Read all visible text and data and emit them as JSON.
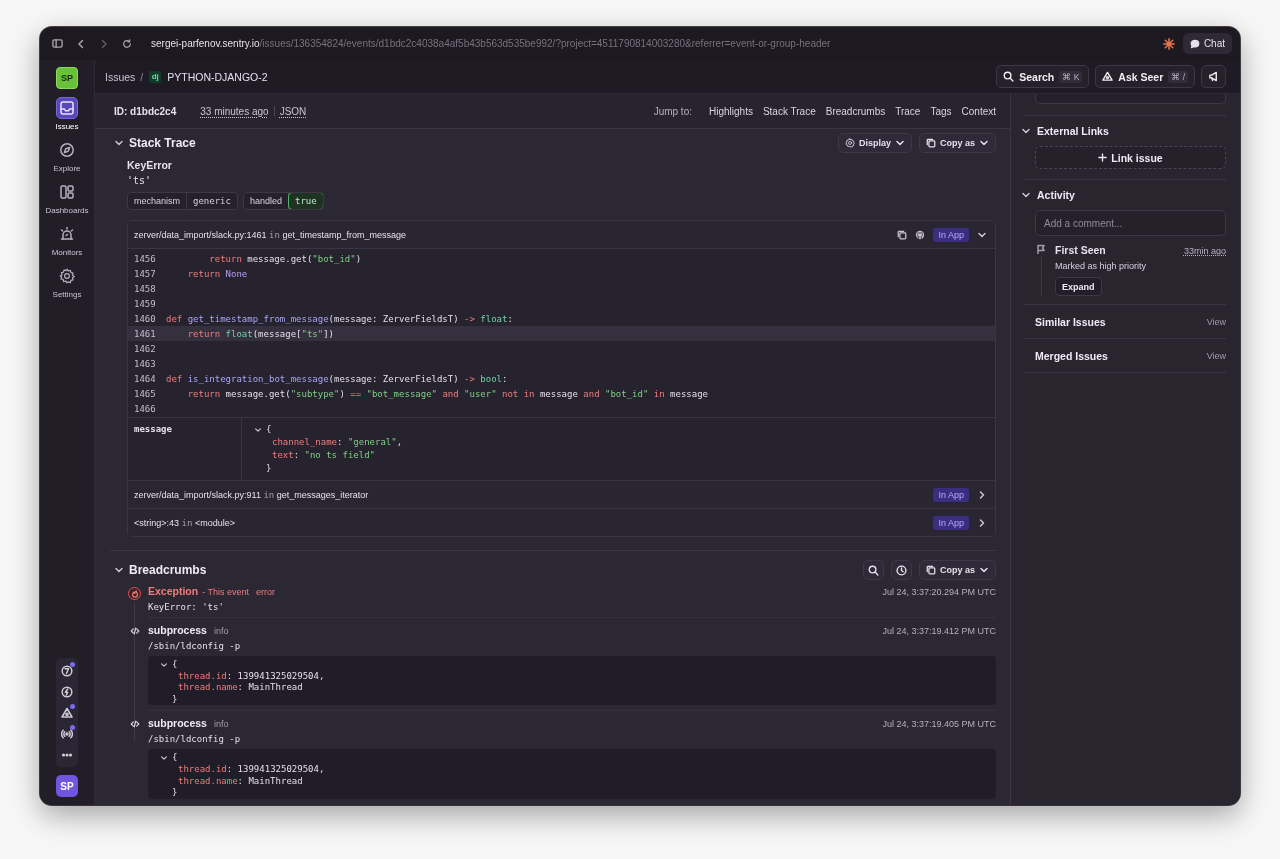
{
  "browser": {
    "url_host": "sergei-parfenov.sentry.io",
    "url_path": "/issues/136354824/events/d1bdc2c4038a4af5b43b563d535be992/?project=4511790814003280&referrer=event-or-group-header",
    "chat": "Chat"
  },
  "org_badge": "SP",
  "nav": [
    {
      "label": "Issues",
      "selected": true
    },
    {
      "label": "Explore",
      "selected": false
    },
    {
      "label": "Dashboards",
      "selected": false
    },
    {
      "label": "Monitors",
      "selected": false
    },
    {
      "label": "Settings",
      "selected": false
    }
  ],
  "nav_tools": [
    {
      "notified": true
    },
    {
      "notified": false
    },
    {
      "notified": true
    },
    {
      "notified": true
    },
    {
      "notified": false
    }
  ],
  "user_avatar": "SP",
  "header": {
    "breadcrumb": "Issues",
    "separator": "/",
    "project_icon": "dj",
    "project": "PYTHON-DJANGO-2",
    "search": "Search",
    "search_key": "⌘ K",
    "seer": "Ask Seer",
    "seer_key": "⌘ /"
  },
  "event": {
    "id": "ID: d1bdc2c4",
    "time": "33 minutes ago",
    "json": "JSON",
    "jump_label": "Jump to:",
    "jump_links": [
      "Highlights",
      "Stack Trace",
      "Breadcrumbs",
      "Trace",
      "Tags",
      "Context"
    ]
  },
  "stack_trace": {
    "title": "Stack Trace",
    "display": "Display",
    "copy": "Copy as",
    "exception_type": "KeyError",
    "exception_value": "'ts'",
    "tags": [
      {
        "key": "mechanism",
        "value": "generic",
        "highlighted": false
      },
      {
        "key": "handled",
        "value": "true",
        "highlighted": true
      }
    ],
    "frames": [
      {
        "file": "zerver/data_import/slack.py:1461",
        "in": "in",
        "function": "get_timestamp_from_message",
        "badge": "In App",
        "expanded": true,
        "lines": [
          {
            "number": "1456",
            "active": false,
            "tokens": [
              {
                "text": "        return",
                "kind": "kw"
              },
              {
                "text": " message.get(",
                "kind": "p"
              },
              {
                "text": "\"bot_id\"",
                "kind": "str"
              },
              {
                "text": ")",
                "kind": "p"
              }
            ]
          },
          {
            "number": "1457",
            "active": false,
            "tokens": [
              {
                "text": "    return",
                "kind": "kw"
              },
              {
                "text": " None",
                "kind": "const"
              }
            ]
          },
          {
            "number": "1458",
            "active": false
          },
          {
            "number": "1459",
            "active": false
          },
          {
            "number": "1460",
            "active": false,
            "tokens": [
              {
                "text": "def",
                "kind": "kw"
              },
              {
                "text": " get_timestamp_from_message",
                "kind": "fn"
              },
              {
                "text": "(message: ZerverFieldsT) ",
                "kind": "p"
              },
              {
                "text": "->",
                "kind": "kw"
              },
              {
                "text": " float",
                "kind": "builtin"
              },
              {
                "text": ":",
                "kind": "p"
              }
            ]
          },
          {
            "number": "1461",
            "active": true,
            "tokens": [
              {
                "text": "    return",
                "kind": "kw"
              },
              {
                "text": " float",
                "kind": "builtin"
              },
              {
                "text": "(message[",
                "kind": "p"
              },
              {
                "text": "\"ts\"",
                "kind": "str"
              },
              {
                "text": "])",
                "kind": "p"
              }
            ]
          },
          {
            "number": "1462",
            "active": false
          },
          {
            "number": "1463",
            "active": false
          },
          {
            "number": "1464",
            "active": false,
            "tokens": [
              {
                "text": "def",
                "kind": "kw"
              },
              {
                "text": " is_integration_bot_message",
                "kind": "fn"
              },
              {
                "text": "(message: ZerverFieldsT) ",
                "kind": "p"
              },
              {
                "text": "->",
                "kind": "kw"
              },
              {
                "text": " bool",
                "kind": "builtin"
              },
              {
                "text": ":",
                "kind": "p"
              }
            ]
          },
          {
            "number": "1465",
            "active": false,
            "tokens": [
              {
                "text": "    return",
                "kind": "kw"
              },
              {
                "text": " message.get(",
                "kind": "p"
              },
              {
                "text": "\"subtype\"",
                "kind": "str"
              },
              {
                "text": ") ",
                "kind": "p"
              },
              {
                "text": "==",
                "kind": "kw"
              },
              {
                "text": " \"bot_message\"",
                "kind": "str"
              },
              {
                "text": " and",
                "kind": "kw"
              },
              {
                "text": " \"user\"",
                "kind": "str"
              },
              {
                "text": " not in",
                "kind": "kw"
              },
              {
                "text": " message ",
                "kind": "p"
              },
              {
                "text": "and",
                "kind": "kw"
              },
              {
                "text": " \"bot_id\"",
                "kind": "str"
              },
              {
                "text": " in",
                "kind": "kw"
              },
              {
                "text": " message",
                "kind": "p"
              }
            ]
          },
          {
            "number": "1466",
            "active": false
          }
        ],
        "variables": [
          {
            "name": "message",
            "lines": [
              [
                {
                  "text": "{",
                  "kind": "p"
                }
              ],
              [
                {
                  "text": "channel_name",
                  "kind": "key"
                },
                {
                  "text": ": ",
                  "kind": "p"
                },
                {
                  "text": "\"general\"",
                  "kind": "str"
                },
                {
                  "text": ",",
                  "kind": "p"
                }
              ],
              [
                {
                  "text": "text",
                  "kind": "key"
                },
                {
                  "text": ": ",
                  "kind": "p"
                },
                {
                  "text": "\"no ts field\"",
                  "kind": "str"
                }
              ],
              [
                {
                  "text": "}",
                  "kind": "p"
                }
              ]
            ]
          }
        ]
      },
      {
        "file": "zerver/data_import/slack.py:911",
        "in": "in",
        "function": "get_messages_iterator",
        "badge": "In App",
        "expanded": false
      },
      {
        "file": "<string>:43",
        "in": "in",
        "function": "<module>",
        "badge": "In App",
        "expanded": false
      }
    ]
  },
  "breadcrumbs": {
    "title": "Breadcrumbs",
    "copy": "Copy as",
    "items": [
      {
        "kind": "exception",
        "title": "Exception",
        "note": "- This event",
        "level": "error",
        "message": "KeyError: 'ts'",
        "time": "Jul 24, 3:37:20.294 PM UTC"
      },
      {
        "kind": "subprocess",
        "title": "subprocess",
        "level": "info",
        "message": "/sbin/ldconfig -p",
        "time": "Jul 24, 3:37:19.412 PM UTC",
        "data": [
          [
            {
              "text": "{",
              "kind": "p"
            }
          ],
          [
            {
              "text": "thread.id",
              "kind": "key"
            },
            {
              "text": ": 139941325029504,",
              "kind": "p"
            }
          ],
          [
            {
              "text": "thread.name",
              "kind": "key"
            },
            {
              "text": ": MainThread",
              "kind": "p"
            }
          ],
          [
            {
              "text": "}",
              "kind": "p"
            }
          ]
        ]
      },
      {
        "kind": "subprocess",
        "title": "subprocess",
        "level": "info",
        "message": "/sbin/ldconfig -p",
        "time": "Jul 24, 3:37:19.405 PM UTC",
        "data": [
          [
            {
              "text": "{",
              "kind": "p"
            }
          ],
          [
            {
              "text": "thread.id",
              "kind": "key"
            },
            {
              "text": ": 139941325029504,",
              "kind": "p"
            }
          ],
          [
            {
              "text": "thread.name",
              "kind": "key"
            },
            {
              "text": ": MainThread",
              "kind": "p"
            }
          ],
          [
            {
              "text": "}",
              "kind": "p"
            }
          ]
        ]
      }
    ]
  },
  "sidebar": {
    "external_links": {
      "title": "External Links",
      "button": "Link issue"
    },
    "activity": {
      "title": "Activity",
      "placeholder": "Add a comment...",
      "items": [
        {
          "title": "First Seen",
          "time": "33min ago",
          "text": "Marked as high priority",
          "button": "Expand"
        }
      ]
    },
    "links": [
      {
        "title": "Similar Issues",
        "action": "View"
      },
      {
        "title": "Merged Issues",
        "action": "View"
      }
    ]
  }
}
